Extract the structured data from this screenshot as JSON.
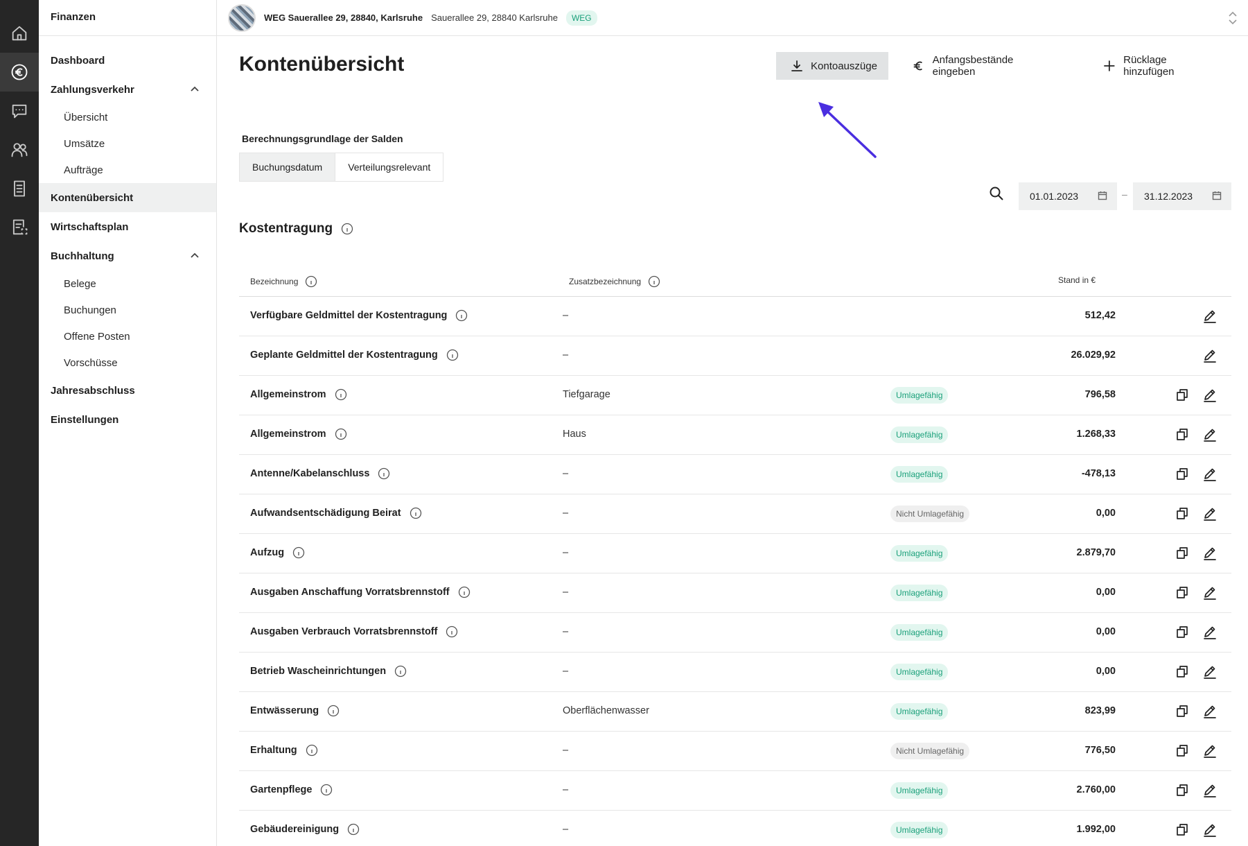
{
  "rail": {
    "items": [
      {
        "icon": "home-icon"
      },
      {
        "icon": "euro-icon",
        "active": true
      },
      {
        "icon": "chat-icon"
      },
      {
        "icon": "people-icon"
      },
      {
        "icon": "document-list-icon"
      },
      {
        "icon": "document-scan-icon"
      }
    ]
  },
  "sidebar": {
    "title": "Finanzen",
    "items": [
      {
        "label": "Dashboard"
      },
      {
        "label": "Zahlungsverkehr",
        "expanded": true
      },
      {
        "label": "Übersicht"
      },
      {
        "label": "Umsätze"
      },
      {
        "label": "Aufträge"
      },
      {
        "label": "Kontenübersicht",
        "active": true
      },
      {
        "label": "Wirtschaftsplan"
      },
      {
        "label": "Buchhaltung",
        "expanded": true
      },
      {
        "label": "Belege"
      },
      {
        "label": "Buchungen"
      },
      {
        "label": "Offene Posten"
      },
      {
        "label": "Vorschüsse"
      },
      {
        "label": "Jahresabschluss"
      },
      {
        "label": "Einstellungen"
      }
    ]
  },
  "topbar": {
    "property_title": "WEG Sauerallee 29, 28840, Karlsruhe",
    "property_address": "Sauerallee 29, 28840 Karlsruhe",
    "badge": "WEG"
  },
  "page": {
    "title": "Kontenübersicht",
    "actions": {
      "statements": "Kontoauszüge",
      "opening_balances": "Anfangsbestände eingeben",
      "add_reserve": "Rücklage hinzufügen"
    },
    "basis_label": "Berechnungsgrundlage der Salden",
    "basis_options": [
      "Buchungsdatum",
      "Verteilungsrelevant"
    ],
    "date_from": "01.01.2023",
    "date_to": "31.12.2023",
    "date_separator": "–"
  },
  "section": {
    "title": "Kostentragung",
    "columns": {
      "name": "Bezeichnung",
      "extra": "Zusatzbezeichnung",
      "amount": "Stand in €"
    },
    "rows": [
      {
        "name": "Verfügbare Geldmittel der Kostentragung",
        "extra": "–",
        "badge": "",
        "amount": "512,42",
        "copy": false
      },
      {
        "name": "Geplante Geldmittel der Kostentragung",
        "extra": "–",
        "badge": "",
        "amount": "26.029,92",
        "copy": false
      },
      {
        "name": "Allgemeinstrom",
        "extra": "Tiefgarage",
        "badge": "Umlagefähig",
        "amount": "796,58",
        "copy": true
      },
      {
        "name": "Allgemeinstrom",
        "extra": "Haus",
        "badge": "Umlagefähig",
        "amount": "1.268,33",
        "copy": true
      },
      {
        "name": "Antenne/Kabelanschluss",
        "extra": "–",
        "badge": "Umlagefähig",
        "amount": "-478,13",
        "copy": true
      },
      {
        "name": "Aufwandsentschädigung Beirat",
        "extra": "–",
        "badge": "Nicht Umlagefähig",
        "amount": "0,00",
        "copy": true
      },
      {
        "name": "Aufzug",
        "extra": "–",
        "badge": "Umlagefähig",
        "amount": "2.879,70",
        "copy": true
      },
      {
        "name": "Ausgaben Anschaffung Vorratsbrennstoff",
        "extra": "–",
        "badge": "Umlagefähig",
        "amount": "0,00",
        "copy": true
      },
      {
        "name": "Ausgaben Verbrauch Vorratsbrennstoff",
        "extra": "–",
        "badge": "Umlagefähig",
        "amount": "0,00",
        "copy": true
      },
      {
        "name": "Betrieb Wascheinrichtungen",
        "extra": "–",
        "badge": "Umlagefähig",
        "amount": "0,00",
        "copy": true
      },
      {
        "name": "Entwässerung",
        "extra": "Oberflächenwasser",
        "badge": "Umlagefähig",
        "amount": "823,99",
        "copy": true
      },
      {
        "name": "Erhaltung",
        "extra": "–",
        "badge": "Nicht Umlagefähig",
        "amount": "776,50",
        "copy": true
      },
      {
        "name": "Gartenpflege",
        "extra": "–",
        "badge": "Umlagefähig",
        "amount": "2.760,00",
        "copy": true
      },
      {
        "name": "Gebäudereinigung",
        "extra": "–",
        "badge": "Umlagefähig",
        "amount": "1.992,00",
        "copy": true
      }
    ]
  },
  "colors": {
    "rail_bg": "#262626",
    "badge_green": "#1aa07a",
    "annotation_arrow": "#4a2ee0"
  }
}
